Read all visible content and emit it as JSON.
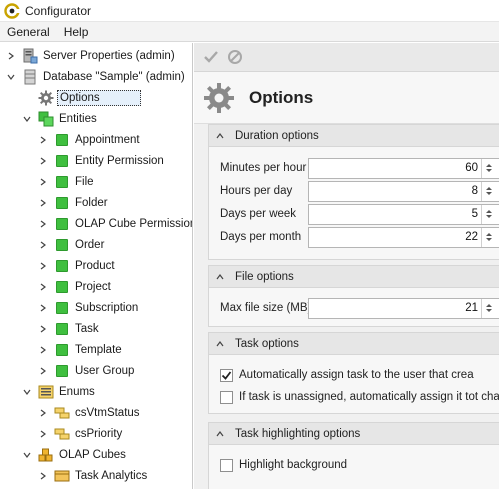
{
  "window": {
    "title": "Configurator"
  },
  "menu": {
    "items": [
      "General",
      "Help"
    ]
  },
  "tree": {
    "server": "Server Properties (admin)",
    "database": "Database \"Sample\" (admin)",
    "options": "Options",
    "entities": "Entities",
    "entity_items": [
      "Appointment",
      "Entity Permission",
      "File",
      "Folder",
      "OLAP Cube Permission",
      "Order",
      "Product",
      "Project",
      "Subscription",
      "Task",
      "Template",
      "User Group"
    ],
    "enums": "Enums",
    "enum_items": [
      "csVtmStatus",
      "csPriority"
    ],
    "olap": "OLAP Cubes",
    "olap_items": [
      "Task Analytics"
    ]
  },
  "page": {
    "title": "Options"
  },
  "duration": {
    "title": "Duration options",
    "fields": [
      {
        "label": "Minutes per hour",
        "value": "60"
      },
      {
        "label": "Hours per day",
        "value": "8"
      },
      {
        "label": "Days per week",
        "value": "5"
      },
      {
        "label": "Days per month",
        "value": "22"
      }
    ]
  },
  "file": {
    "title": "File options",
    "fields": [
      {
        "label": "Max file size (MB)",
        "value": "21"
      }
    ]
  },
  "task": {
    "title": "Task options",
    "auto_assign": {
      "label": "Automatically assign task to the user that crea",
      "checked": true
    },
    "unassigned": {
      "label": "If task is unassigned, automatically assign it tot chang",
      "checked": false
    }
  },
  "highlight": {
    "title": "Task highlighting options",
    "background": {
      "label": "Highlight background",
      "checked": false
    }
  }
}
